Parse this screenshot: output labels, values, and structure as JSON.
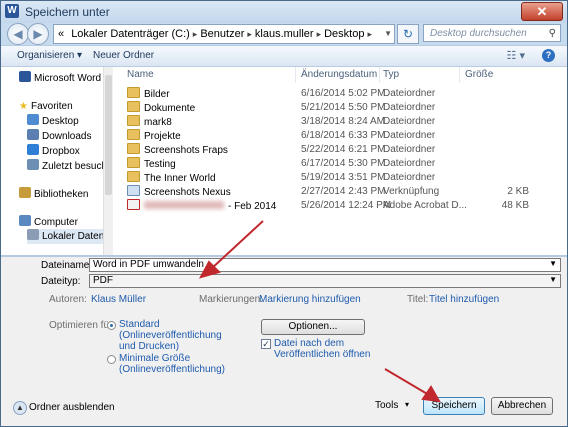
{
  "window": {
    "title": "Speichern unter",
    "close_glyph": "✕"
  },
  "nav": {
    "back_glyph": "◀",
    "forward_glyph": "▶",
    "crumb_prefix": "«",
    "breadcrumb": [
      "Lokaler Datenträger (C:)",
      "Benutzer",
      "klaus.muller",
      "Desktop"
    ],
    "separator": "▸",
    "search_placeholder": "Desktop durchsuchen",
    "search_glyph": "⚲",
    "refresh_glyph": "↻"
  },
  "toolbar": {
    "organize_label": "Organisieren ▾",
    "new_folder_label": "Neuer Ordner",
    "view_glyph": "☷ ▾",
    "help_glyph": "?"
  },
  "sidebar": {
    "items": [
      {
        "label": "Microsoft Word",
        "icon": "word-icon",
        "color": "#2b579a"
      },
      {
        "label": "Favoriten",
        "icon": "star-icon",
        "color": "#e8b923"
      },
      {
        "label": "Desktop",
        "icon": "desktop-icon",
        "color": "#4f8bd0"
      },
      {
        "label": "Downloads",
        "icon": "downloads-icon",
        "color": "#5a7fb0"
      },
      {
        "label": "Dropbox",
        "icon": "dropbox-icon",
        "color": "#2f7fd6"
      },
      {
        "label": "Zuletzt besucht",
        "icon": "recent-places-icon",
        "color": "#6e8fb4"
      },
      {
        "label": "Bibliotheken",
        "icon": "libraries-icon",
        "color": "#c69c3b"
      },
      {
        "label": "Computer",
        "icon": "computer-icon",
        "color": "#5a88c0"
      },
      {
        "label": "Lokaler Datenträ",
        "icon": "drive-icon",
        "color": "#8a9db5"
      }
    ]
  },
  "filelist": {
    "columns": [
      "Name",
      "Änderungsdatum",
      "Typ",
      "Größe"
    ],
    "rows": [
      {
        "name": "Bilder",
        "date": "6/16/2014 5:02 PM",
        "type": "Dateiordner",
        "size": "",
        "icon": "folder-icon"
      },
      {
        "name": "Dokumente",
        "date": "5/21/2014 5:50 PM",
        "type": "Dateiordner",
        "size": "",
        "icon": "folder-icon"
      },
      {
        "name": "mark8",
        "date": "3/18/2014 8:24 AM",
        "type": "Dateiordner",
        "size": "",
        "icon": "folder-icon"
      },
      {
        "name": "Projekte",
        "date": "6/18/2014 6:33 PM",
        "type": "Dateiordner",
        "size": "",
        "icon": "folder-icon"
      },
      {
        "name": "Screenshots Fraps",
        "date": "5/22/2014 6:21 PM",
        "type": "Dateiordner",
        "size": "",
        "icon": "folder-icon"
      },
      {
        "name": "Testing",
        "date": "6/17/2014 5:30 PM",
        "type": "Dateiordner",
        "size": "",
        "icon": "folder-icon"
      },
      {
        "name": "The Inner World",
        "date": "5/19/2014 3:51 PM",
        "type": "Dateiordner",
        "size": "",
        "icon": "folder-icon"
      },
      {
        "name": "Screenshots Nexus",
        "date": "2/27/2014 2:43 PM",
        "type": "Verknüpfung",
        "size": "2 KB",
        "icon": "shortcut-icon"
      },
      {
        "name": "- Feb 2014",
        "date": "5/26/2014 12:24 PM",
        "type": "Adobe Acrobat D...",
        "size": "48 KB",
        "icon": "pdf-icon"
      }
    ]
  },
  "form": {
    "filename_label": "Dateiname:",
    "filename_value": "Word in PDF umwandeln",
    "filetype_label": "Dateityp:",
    "filetype_value": "PDF",
    "authors_label": "Autoren:",
    "authors_value": "Klaus Müller",
    "tags_label": "Markierungen:",
    "tags_value": "Markierung hinzufügen",
    "title_label": "Titel:",
    "title_value": "Titel hinzufügen",
    "optimize_label": "Optimieren für:",
    "optimize_standard": "Standard (Onlineveröffentlichung und Drucken)",
    "optimize_minimal": "Minimale Größe (Onlineveröffentlichung)",
    "options_button": "Optionen...",
    "open_after_publish": "Datei nach dem Veröffentlichen öffnen",
    "dropdown_glyph": "▼"
  },
  "footer": {
    "hide_folders": "Ordner ausblenden",
    "tools": "Tools",
    "tools_glyph": "▾",
    "save": "Speichern",
    "cancel": "Abbrechen"
  },
  "annotation_color": "#c0282d"
}
